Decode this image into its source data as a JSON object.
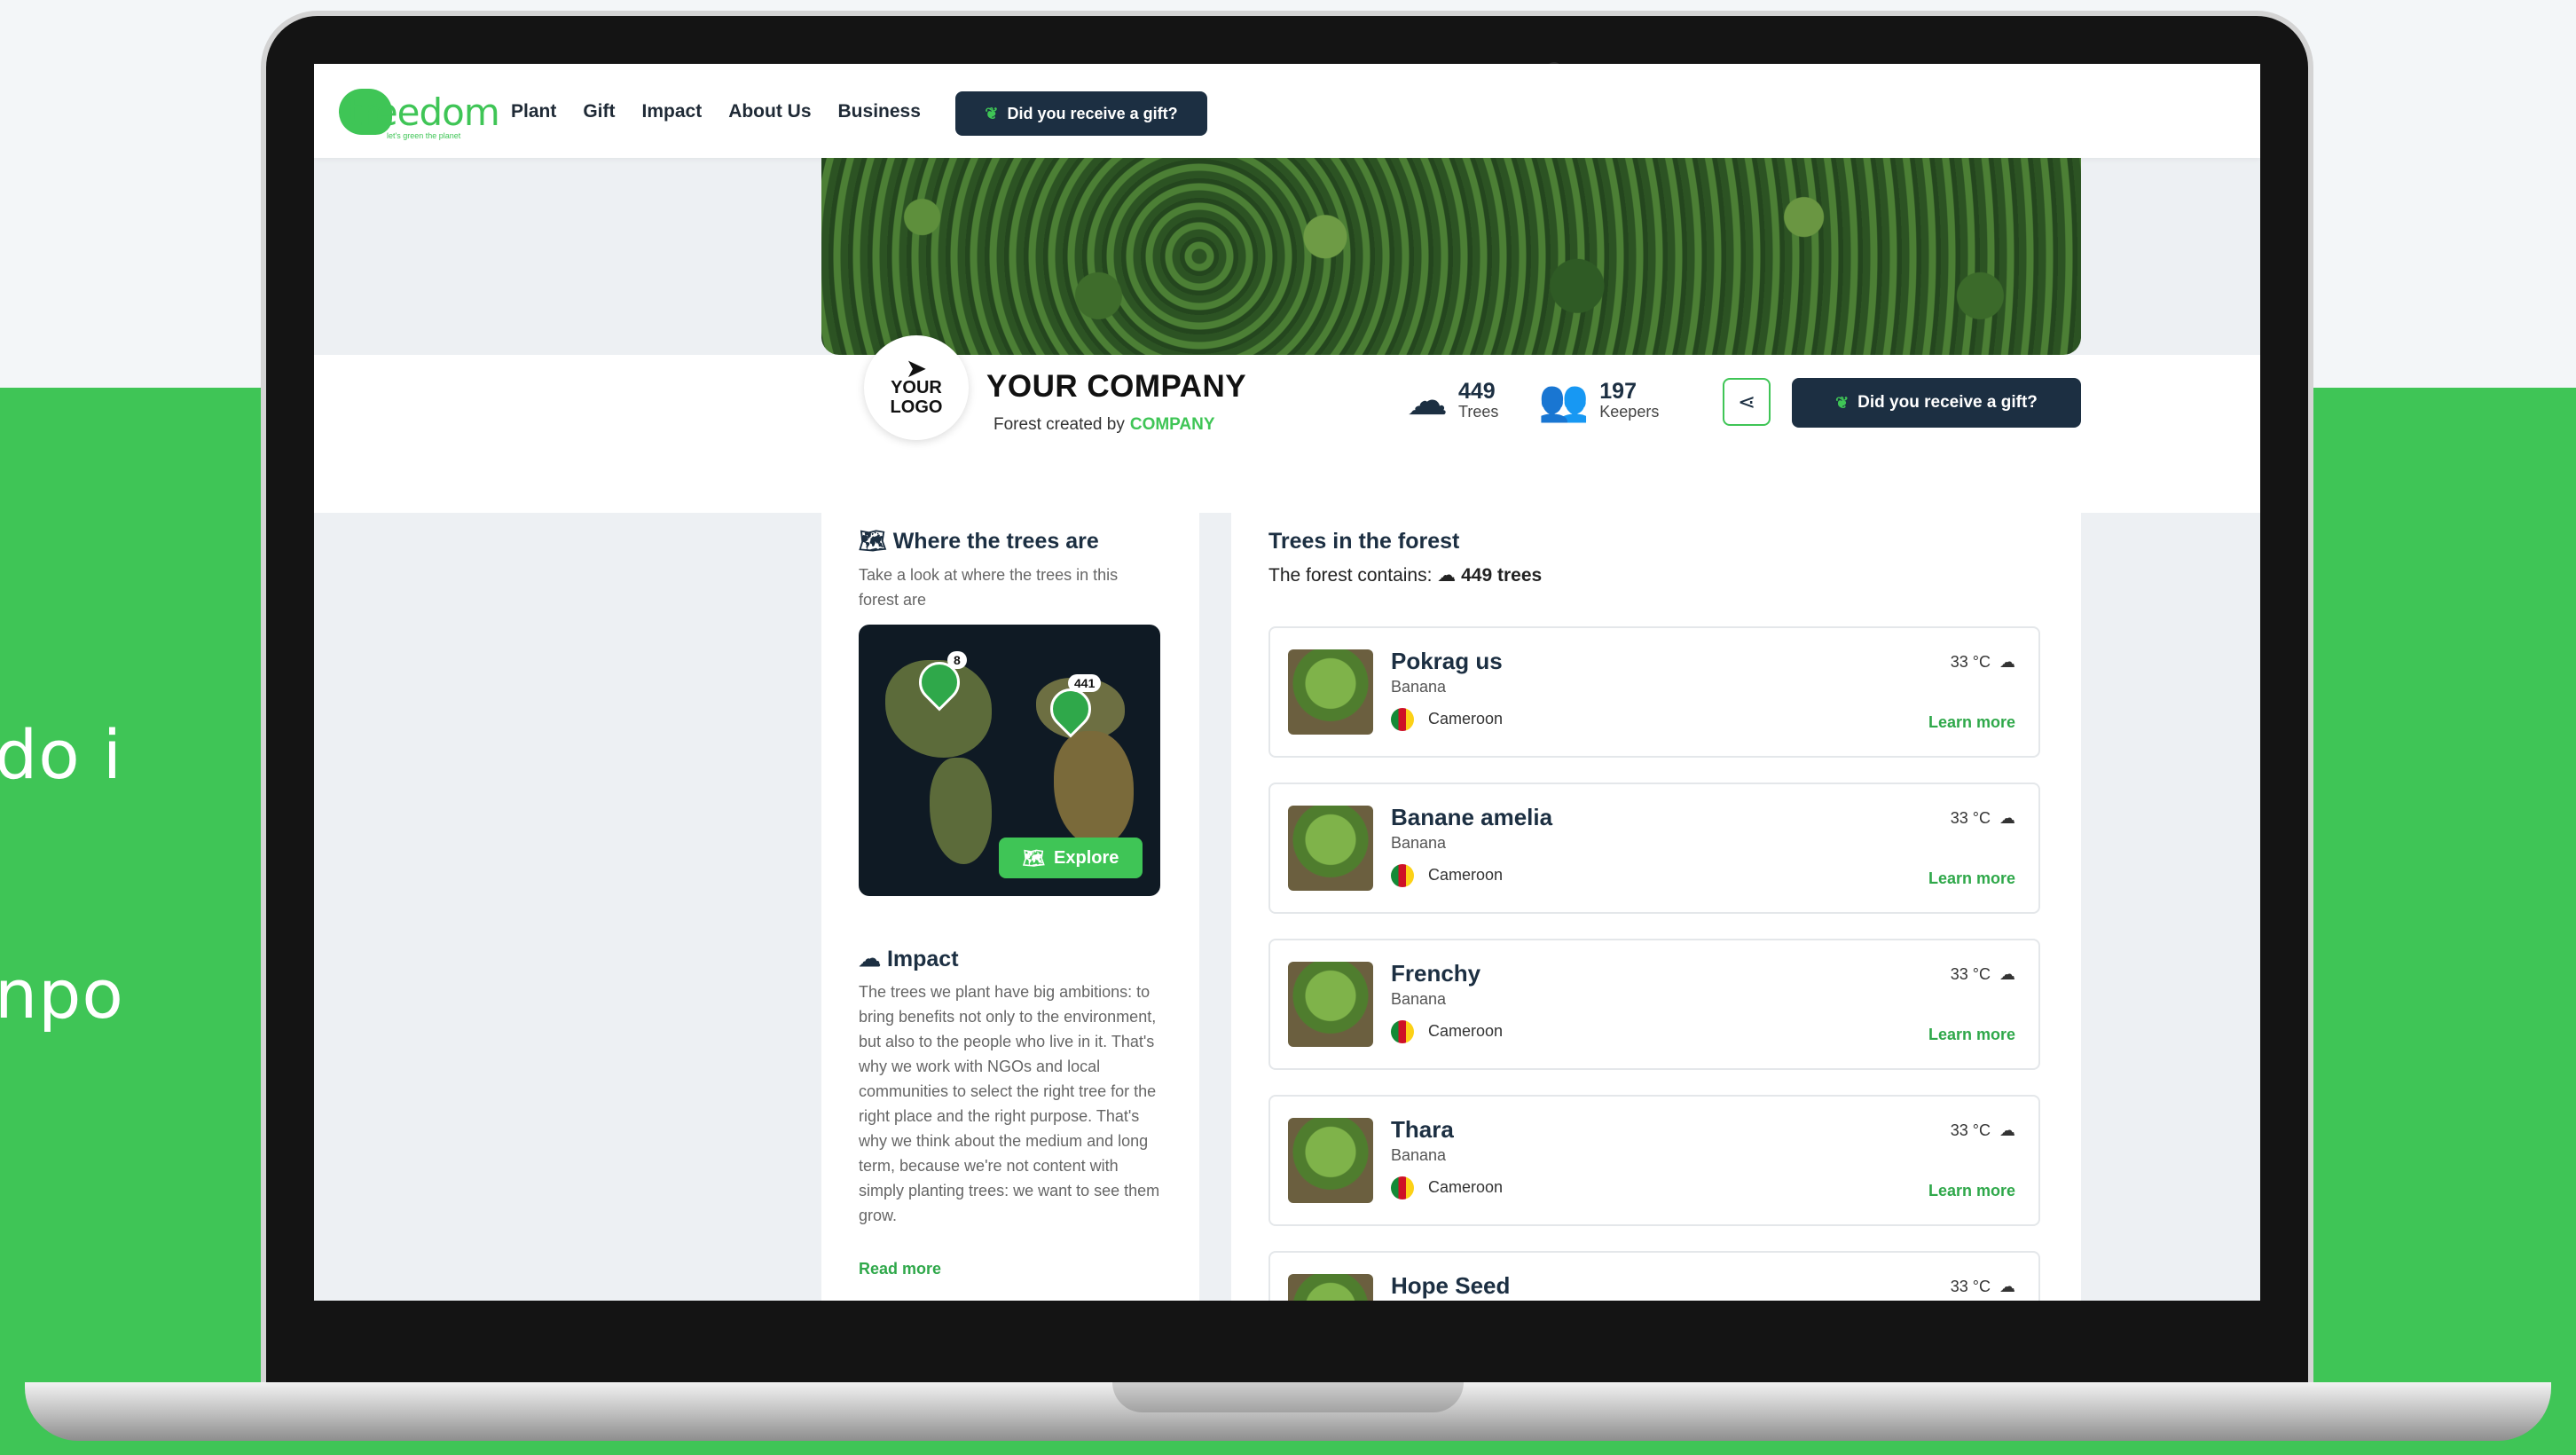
{
  "side_text": [
    "do i",
    "npo"
  ],
  "nav": {
    "logo_word": "treedom",
    "logo_tagline": "let's green the planet",
    "menu": [
      "Plant",
      "Gift",
      "Impact",
      "About Us",
      "Business"
    ],
    "gift_button": "Did you receive a gift?"
  },
  "company": {
    "logo_line1": "YOUR",
    "logo_line2": "LOGO",
    "name": "YOUR COMPANY",
    "created_by_label": "Forest created by",
    "created_by_value": "COMPANY",
    "trees_count": "449",
    "trees_label": "Trees",
    "keepers_count": "197",
    "keepers_label": "Keepers",
    "gift_button": "Did you receive a gift?"
  },
  "where": {
    "title": "Where the trees are",
    "subtitle": "Take a look at where the trees in this forest are",
    "pin1_count": "8",
    "pin2_count": "441",
    "explore_button": "Explore"
  },
  "impact": {
    "title": "Impact",
    "body": "The trees we plant have big ambitions: to bring benefits not only to the environment, but also to the people who live in it. That's why we work with NGOs and local communities to select the right tree for the right place and the right purpose. That's why we think about the medium and long term, because we're not content with simply planting trees: we want to see them grow.",
    "read_more": "Read more"
  },
  "forest": {
    "title": "Trees in the forest",
    "contains_label": "The forest contains:",
    "contains_value": "449 trees",
    "trees": [
      {
        "name": "Pokrag us",
        "species": "Banana",
        "country": "Cameroon",
        "temp": "33 °C",
        "link": "Learn more"
      },
      {
        "name": "Banane amelia",
        "species": "Banana",
        "country": "Cameroon",
        "temp": "33 °C",
        "link": "Learn more"
      },
      {
        "name": "Frenchy",
        "species": "Banana",
        "country": "Cameroon",
        "temp": "33 °C",
        "link": "Learn more"
      },
      {
        "name": "Thara",
        "species": "Banana",
        "country": "Cameroon",
        "temp": "33 °C",
        "link": "Learn more"
      },
      {
        "name": "Hope Seed",
        "species": "",
        "country": "",
        "temp": "33 °C",
        "link": ""
      }
    ]
  },
  "colors": {
    "brand_green": "#3fc556",
    "dark_navy": "#1c2f42",
    "background_green": "#3fc556"
  }
}
